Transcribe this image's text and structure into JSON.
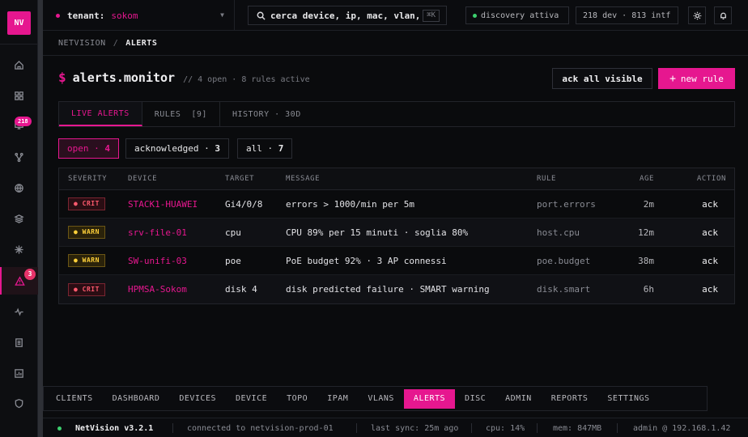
{
  "app": {
    "logo": "NV",
    "name": "NetVision v3.2.1",
    "accent": "#e6178f"
  },
  "rail": {
    "items": [
      {
        "id": "home",
        "icon": "home-icon"
      },
      {
        "id": "dashboard",
        "icon": "grid-icon"
      },
      {
        "id": "devices",
        "icon": "monitor-icon",
        "badge": "218"
      },
      {
        "id": "topology",
        "icon": "branch-icon"
      },
      {
        "id": "ipam",
        "icon": "globe-icon"
      },
      {
        "id": "vlans",
        "icon": "layers-icon"
      },
      {
        "id": "discovery",
        "icon": "sparkle-icon"
      },
      {
        "id": "alerts",
        "icon": "warning-icon",
        "badge": "3",
        "active": true
      },
      {
        "id": "activity",
        "icon": "pulse-icon"
      },
      {
        "id": "reports",
        "icon": "document-icon"
      },
      {
        "id": "stats",
        "icon": "chart-icon"
      },
      {
        "id": "security",
        "icon": "shield-icon"
      }
    ]
  },
  "topbar": {
    "tenant_label": "tenant:",
    "tenant_value": "sokom",
    "search_placeholder": "cerca device, ip, mac, vlan,",
    "search_shortcut": "⌘K",
    "discovery_status": "discovery attiva",
    "counts": "218 dev · 813 intf"
  },
  "breadcrumb": {
    "root": "NETVISION",
    "separator": "/",
    "current": "ALERTS"
  },
  "header": {
    "prompt": "$",
    "title": "alerts.monitor",
    "subtitle": "// 4 open · 8 rules active",
    "ack_all_label": "ack all visible",
    "new_rule_plus": "+",
    "new_rule_label": "new rule"
  },
  "tabs": [
    {
      "label": "LIVE ALERTS",
      "active": true
    },
    {
      "label": "RULES  [9]"
    },
    {
      "label": "HISTORY · 30D"
    }
  ],
  "filters": [
    {
      "label": "open · ",
      "count": "4",
      "active": true
    },
    {
      "label": "acknowledged · ",
      "count": "3"
    },
    {
      "label": "all · ",
      "count": "7"
    }
  ],
  "table": {
    "headers": [
      "SEVERITY",
      "DEVICE",
      "TARGET",
      "MESSAGE",
      "RULE",
      "AGE",
      "ACTION"
    ],
    "rows": [
      {
        "severity": "CRIT",
        "severity_class": "crit",
        "device": "STACK1-HUAWEI",
        "target": "Gi4/0/8",
        "message": "errors > 1000/min per 5m",
        "rule": "port.errors",
        "age": "2m",
        "action": "ack"
      },
      {
        "severity": "WARN",
        "severity_class": "warn",
        "device": "srv-file-01",
        "target": "cpu",
        "message": "CPU 89% per 15 minuti · soglia 80%",
        "rule": "host.cpu",
        "age": "12m",
        "action": "ack"
      },
      {
        "severity": "WARN",
        "severity_class": "warn",
        "device": "SW-unifi-03",
        "target": "poe",
        "message": "PoE budget 92% · 3 AP connessi",
        "rule": "poe.budget",
        "age": "38m",
        "action": "ack"
      },
      {
        "severity": "CRIT",
        "severity_class": "crit",
        "device": "HPMSA-Sokom",
        "target": "disk 4",
        "message": "disk predicted failure · SMART warning",
        "rule": "disk.smart",
        "age": "6h",
        "action": "ack"
      }
    ]
  },
  "bottom_nav": [
    {
      "label": "CLIENTS"
    },
    {
      "label": "DASHBOARD"
    },
    {
      "label": "DEVICES"
    },
    {
      "label": "DEVICE"
    },
    {
      "label": "TOPO"
    },
    {
      "label": "IPAM"
    },
    {
      "label": "VLANS"
    },
    {
      "label": "ALERTS",
      "active": true
    },
    {
      "label": "DISC"
    },
    {
      "label": "ADMIN"
    },
    {
      "label": "REPORTS"
    },
    {
      "label": "SETTINGS"
    }
  ],
  "statusbar": {
    "app": "NetVision v3.2.1",
    "connection": "connected to netvision-prod-01",
    "last_sync": "last sync: 25m ago",
    "cpu": "cpu: 14%",
    "mem": "mem: 847MB",
    "user": "admin @ 192.168.1.42"
  },
  "colors": {
    "accent": "#e6178f",
    "crit": "#ff5a6e",
    "warn": "#ffd13a",
    "ok": "#3ccf6e"
  }
}
